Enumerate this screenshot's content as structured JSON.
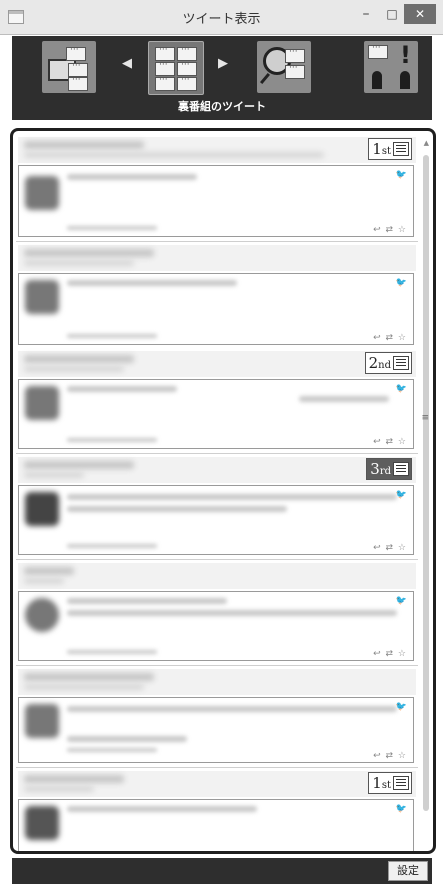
{
  "window": {
    "title": "ツイート表示",
    "minimize": "–",
    "maximize": "□",
    "close": "✕"
  },
  "nav": {
    "arrow_left": "◀",
    "arrow_right": "▶",
    "caption": "裏番組のツイート",
    "exclaim": "!"
  },
  "tweets": {
    "bird": "🐦",
    "actions": "↩ ⇄ ☆"
  },
  "ranks": {
    "first": {
      "num": "1",
      "suffix": "st"
    },
    "second": {
      "num": "2",
      "suffix": "nd"
    },
    "third": {
      "num": "3",
      "suffix": "rd"
    },
    "first_again": {
      "num": "1",
      "suffix": "st"
    }
  },
  "scrollbar": {
    "up_arrow": "▲",
    "grip": "≡"
  },
  "bottom": {
    "settings_label": "設定"
  }
}
